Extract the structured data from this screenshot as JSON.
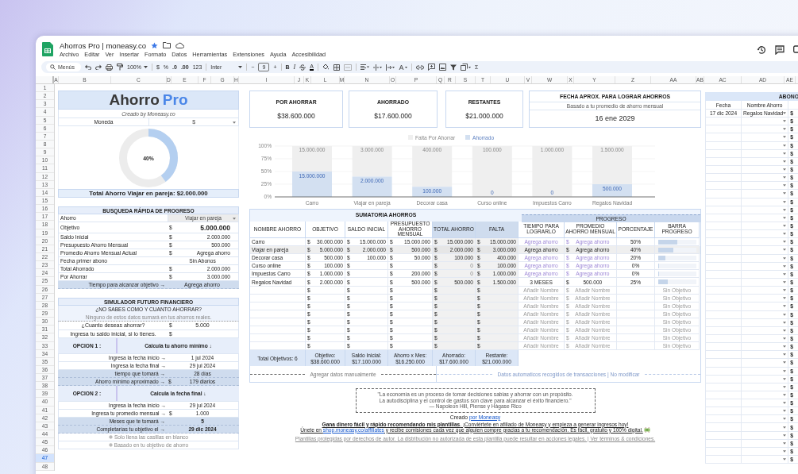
{
  "window": {
    "title": "Ahorros Pro | moneasy.co",
    "menu": [
      "Archivo",
      "Editar",
      "Ver",
      "Insertar",
      "Formato",
      "Datos",
      "Herramientas",
      "Extensiones",
      "Ayuda",
      "Accesibilidad"
    ]
  },
  "toolbar": {
    "search": "Menús",
    "zoom": "100%",
    "currency": "$",
    "percent": "%",
    "dec_less": ".0",
    "dec_more": ".00",
    "format": "123",
    "font": "Inter",
    "minus": "−",
    "font_size": "9",
    "plus": "+",
    "bold": "B",
    "italic": "I",
    "text_color": "A",
    "sum": "Σ"
  },
  "columns": [
    "A",
    "B",
    "C",
    "D",
    "E",
    "F",
    "G",
    "H",
    "I",
    "J",
    "K",
    "L",
    "M",
    "N",
    "O",
    "P",
    "Q",
    "R",
    "S",
    "T",
    "U",
    "V",
    "W",
    "X",
    "Y",
    "Z",
    "AA",
    "AB",
    "AC",
    "AD",
    "AE"
  ],
  "rows": [
    {
      "label": "1",
      "selected": false
    },
    {
      "label": "2",
      "selected": false
    },
    {
      "label": "3",
      "selected": false
    },
    {
      "label": "4",
      "selected": false
    },
    {
      "label": "5",
      "selected": false
    },
    {
      "label": "6",
      "selected": false
    },
    {
      "label": "7",
      "selected": false
    },
    {
      "label": "8",
      "selected": false
    },
    {
      "label": "9",
      "selected": false
    },
    {
      "label": "10",
      "selected": false
    },
    {
      "label": "11",
      "selected": false
    },
    {
      "label": "12",
      "selected": false
    },
    {
      "label": "13",
      "selected": false
    },
    {
      "label": "14",
      "selected": false
    },
    {
      "label": "15",
      "selected": false
    },
    {
      "label": "16",
      "selected": false
    },
    {
      "label": "17",
      "selected": false
    },
    {
      "label": "18",
      "selected": false
    },
    {
      "label": "19",
      "selected": false
    },
    {
      "label": "20",
      "selected": false
    },
    {
      "label": "21",
      "selected": false
    },
    {
      "label": "22",
      "selected": false
    },
    {
      "label": "23",
      "selected": false
    },
    {
      "label": "24",
      "selected": false
    },
    {
      "label": "25",
      "selected": false
    },
    {
      "label": "26",
      "selected": false
    },
    {
      "label": "27",
      "selected": false
    },
    {
      "label": "28",
      "selected": false
    },
    {
      "label": "29",
      "selected": false
    },
    {
      "label": "30",
      "selected": false
    },
    {
      "label": "31",
      "selected": false
    },
    {
      "label": "32",
      "selected": false
    },
    {
      "label": "33",
      "selected": false
    },
    {
      "label": "34",
      "selected": false
    },
    {
      "label": "35",
      "selected": false
    },
    {
      "label": "36",
      "selected": false
    },
    {
      "label": "37",
      "selected": false
    },
    {
      "label": "38",
      "selected": false
    },
    {
      "label": "39",
      "selected": false
    },
    {
      "label": "40",
      "selected": false
    },
    {
      "label": "41",
      "selected": false
    },
    {
      "label": "42",
      "selected": false
    },
    {
      "label": "43",
      "selected": false
    },
    {
      "label": "44",
      "selected": false
    },
    {
      "label": "45",
      "selected": false
    },
    {
      "label": "46",
      "selected": false
    },
    {
      "label": "47",
      "selected": true
    },
    {
      "label": "48",
      "selected": false
    }
  ],
  "left": {
    "title": {
      "main": "Ahorro",
      "accent": "Pro"
    },
    "subtitle": "Creado by Moneasy.co",
    "currency": {
      "label": "Moneda",
      "value": "$"
    },
    "progress": {
      "level": 0.4,
      "reading": "40%"
    },
    "total": "Total Ahorro Viajar en pareja: $2.000.000",
    "search": {
      "title": "BUSQUEDA RÁPIDA DE PROGRESO",
      "select": {
        "label": "Ahorro",
        "value": "Viajar en pareja"
      },
      "rows": [
        {
          "label": "Objetivo",
          "sym": "$",
          "value": "5.000.000",
          "kind": "big"
        },
        {
          "label": "Saldo Inicial",
          "sym": "$",
          "value": "2.000.000",
          "kind": "plain"
        },
        {
          "label": "Presupuesto Ahorro Mensual",
          "sym": "$",
          "value": "500.000",
          "kind": "plain"
        },
        {
          "label": "Promedio Ahorro Mensual Actual",
          "sym": "$",
          "value": "Agrega ahorro",
          "kind": "plain"
        },
        {
          "label": "Fecha primer abono",
          "value": "Sin Abonos",
          "kind": "plain"
        },
        {
          "label": "Total Ahorrado",
          "sym": "$",
          "value": "2.000.000",
          "kind": "plain"
        },
        {
          "label": "Por Ahorrar",
          "sym": "$",
          "value": "3.000.000",
          "kind": "plain"
        }
      ],
      "result": {
        "label": "Tiempo para alcanzar objetivo →",
        "value": "Agrega ahorro"
      }
    },
    "simulator": {
      "title": "SIMULADOR FUTURO FINANCIERO",
      "question": "¿NO SABES COMO Y CUANTO AHORRAR?",
      "note": "Ninguno de estos datos sumará en tus ahorros reales.",
      "inputs": [
        {
          "label": "¿Cuanto deseas ahorrar?",
          "sym": "$",
          "value": "5.000"
        },
        {
          "label": "Ingresa tu saldo inicial, si lo tienes.",
          "sym": "$"
        }
      ],
      "options": [
        {
          "label": "OPCION 1 :",
          "heading": "Calcula tu ahorro mínimo ↓",
          "rows": [
            {
              "label": "Ingresa la fecha inicio →",
              "value": "1 jul 2024",
              "kind": "input"
            },
            {
              "label": "Ingresa la fecha final →",
              "value": "29 jul 2024",
              "kind": "input"
            },
            {
              "label": "tiempo que tomará →",
              "value": "28 días",
              "kind": "result"
            },
            {
              "label": "Ahorro mínimo aproximado →",
              "sym": "$",
              "value": "179 diarios",
              "kind": "result"
            }
          ]
        },
        {
          "label": "OPCION 2 :",
          "heading": "Calcula la fecha final ↓",
          "rows": [
            {
              "label": "Ingresa la fecha inicio →",
              "value": "29 jul 2024",
              "kind": "input"
            },
            {
              "label": "Ingresa tu promedio mensual →",
              "sym": "$",
              "value": "1.000",
              "kind": "input"
            },
            {
              "label": "Meses que te tomará →",
              "value": "5",
              "kind": "strong"
            },
            {
              "label": "Completarías tu objetivo el →",
              "value": "29 dic 2024",
              "kind": "strong"
            }
          ]
        }
      ],
      "hints": [
        "Solo llena las casillas en blanco",
        "Basado en tu objetivo de ahorro"
      ]
    }
  },
  "cards": [
    {
      "label": "POR AHORRAR",
      "value": "$38.600.000"
    },
    {
      "label": "AHORRADO",
      "value": "$17.600.000"
    },
    {
      "label": "RESTANTES",
      "value": "$21.000.000"
    }
  ],
  "date_card": {
    "title": "FECHA APROX. PARA LOGRAR AHORROS",
    "note": "Basado a tu promedio de ahorro mensual",
    "value": "16 ene 2029"
  },
  "chart_data": {
    "type": "bar",
    "stacked": true,
    "ylim": [
      0,
      1
    ],
    "categories": [
      "Carro",
      "Viajar en pareja",
      "Decorar casa",
      "Curso online",
      "Impuestos Carro",
      "Regalos Navidad"
    ],
    "series": [
      {
        "name": "Falta Por Ahorrar",
        "color": "#efefef",
        "values": [
          0.5,
          0.6,
          0.8,
          1,
          1,
          0.75
        ]
      },
      {
        "name": "Ahorrado",
        "color": "#d3e0f1",
        "values": [
          0.5,
          0.4,
          0.2,
          0,
          0,
          0.25
        ]
      }
    ],
    "value_labels": [
      [
        "15.000.000",
        "3.000.000",
        "400.000",
        "100.000",
        "1.000.000",
        "1.500.000"
      ],
      [
        "15.000.000",
        "2.000.000",
        "100.000",
        "0",
        "0",
        "500.000"
      ]
    ],
    "yticks": [
      {
        "value": 0,
        "label": "0%"
      },
      {
        "value": 0.25,
        "label": "25%"
      },
      {
        "value": 0.5,
        "label": "50%"
      },
      {
        "value": 0.75,
        "label": "75%"
      },
      {
        "value": 1,
        "label": "100%"
      }
    ],
    "grid": true,
    "legend": "top"
  },
  "table": {
    "title": "SUMATORIA AHORROS",
    "group": "PROGRESO",
    "columns": [
      "NOMBRE AHORRO",
      "OBJETIVO",
      "SALDO INICIAL",
      "PRESUPUESTO AHORRO MENSUAL",
      "TOTAL AHORRO",
      "FALTA",
      "TIEMPO PARA LOGRARLO",
      "PROMEDIO AHORRO MENSUAL",
      "PORCENTAJE",
      "BARRA PROGRESO"
    ],
    "rows": [
      {
        "kind": "goal",
        "name": "Carro",
        "sym": [
          "$",
          "$",
          "$",
          "$",
          "$",
          "$"
        ],
        "objetivo": "30.000.000",
        "saldo": "15.000.000",
        "presupuesto": "15.000.000",
        "total": "15.000.000",
        "falta": "15.000.000",
        "tiempo": "Agrega ahorro",
        "promedio": "Agrega ahorro",
        "porcentaje": "50%",
        "level": 0.5,
        "dimmed": true,
        "highlighted": false,
        "total_dimmed": false
      },
      {
        "kind": "goal",
        "name": "Viajar en pareja",
        "sym": [
          "$",
          "$",
          "$",
          "$",
          "$",
          "$"
        ],
        "objetivo": "5.000.000",
        "saldo": "2.000.000",
        "presupuesto": "500.000",
        "total": "2.000.000",
        "falta": "3.000.000",
        "tiempo": "Agrega ahorro",
        "promedio": "Agrega ahorro",
        "porcentaje": "40%",
        "level": 0.4,
        "dimmed": false,
        "highlighted": true,
        "total_dimmed": false
      },
      {
        "kind": "goal",
        "name": "Decorar casa",
        "sym": [
          "$",
          "$",
          "$",
          "$",
          "$",
          "$"
        ],
        "objetivo": "500.000",
        "saldo": "100.000",
        "presupuesto": "50.000",
        "total": "100.000",
        "falta": "400.000",
        "tiempo": "Agrega ahorro",
        "promedio": "Agrega ahorro",
        "porcentaje": "20%",
        "level": 0.2,
        "dimmed": true,
        "highlighted": false,
        "total_dimmed": false
      },
      {
        "kind": "goal",
        "name": "Curso online",
        "sym": [
          "$",
          "$",
          "$",
          "$",
          "$",
          "$"
        ],
        "objetivo": "100.000",
        "total": "0",
        "falta": "100.000",
        "tiempo": "Agrega ahorro",
        "promedio": "Agrega ahorro",
        "porcentaje": "0%",
        "level": 0,
        "dimmed": true,
        "highlighted": false,
        "total_dimmed": true
      },
      {
        "kind": "goal",
        "name": "Impuestos Carro",
        "sym": [
          "$",
          "$",
          "$",
          "$",
          "$",
          "$"
        ],
        "objetivo": "1.000.000",
        "presupuesto": "200.000",
        "total": "0",
        "falta": "1.000.000",
        "tiempo": "Agrega ahorro",
        "promedio": "Agrega ahorro",
        "porcentaje": "0%",
        "level": 0,
        "dimmed": true,
        "highlighted": false,
        "total_dimmed": true
      },
      {
        "kind": "goal",
        "name": "Regalos Navidad",
        "sym": [
          "$",
          "$",
          "$",
          "$",
          "$",
          "$"
        ],
        "objetivo": "2.000.000",
        "presupuesto": "500.000",
        "total": "500.000",
        "falta": "1.500.000",
        "tiempo": "3 MESES",
        "promedio": "500.000",
        "porcentaje": "25%",
        "level": 0.25,
        "dimmed": false,
        "highlighted": false,
        "total_dimmed": false
      },
      {
        "kind": "empty",
        "sym": [
          "$",
          "$",
          "$",
          "$",
          "$",
          "$"
        ],
        "tiempo": "Añadir Nombre",
        "promedio": "Añadir Nombre",
        "barra": "Sin Objetivo"
      },
      {
        "kind": "empty",
        "sym": [
          "$",
          "$",
          "$",
          "$",
          "$",
          "$"
        ],
        "tiempo": "Añadir Nombre",
        "promedio": "Añadir Nombre",
        "barra": "Sin Objetivo"
      },
      {
        "kind": "empty",
        "sym": [
          "$",
          "$",
          "$",
          "$",
          "$",
          "$"
        ],
        "tiempo": "Añadir Nombre",
        "promedio": "Añadir Nombre",
        "barra": "Sin Objetivo"
      },
      {
        "kind": "empty",
        "sym": [
          "$",
          "$",
          "$",
          "$",
          "$",
          "$"
        ],
        "tiempo": "Añadir Nombre",
        "promedio": "Añadir Nombre",
        "barra": "Sin Objetivo"
      },
      {
        "kind": "empty",
        "sym": [
          "$",
          "$",
          "$",
          "$",
          "$",
          "$"
        ],
        "tiempo": "Añadir Nombre",
        "promedio": "Añadir Nombre",
        "barra": "Sin Objetivo"
      },
      {
        "kind": "empty",
        "sym": [
          "$",
          "$",
          "$",
          "$",
          "$",
          "$"
        ],
        "tiempo": "Añadir Nombre",
        "promedio": "Añadir Nombre",
        "barra": "Sin Objetivo"
      },
      {
        "kind": "empty",
        "sym": [
          "$",
          "$",
          "$",
          "$",
          "$",
          "$"
        ],
        "tiempo": "Añadir Nombre",
        "promedio": "Añadir Nombre",
        "barra": "Sin Objetivo"
      },
      {
        "kind": "empty",
        "sym": [
          "$",
          "$",
          "$",
          "$",
          "$",
          "$"
        ],
        "tiempo": "Añadir Nombre",
        "promedio": "Añadir Nombre",
        "barra": "Sin Objetivo"
      }
    ],
    "totals_label": "Total Objetivos: 6",
    "totals": [
      {
        "label": "Objetivo:",
        "value": "$38.600.000"
      },
      {
        "label": "Saldo Inicial:",
        "value": "$17.100.000"
      },
      {
        "label": "Ahorro x Mes:",
        "value": "$16.250.000"
      },
      {
        "label": "Ahorrado:",
        "value": "$17.600.000"
      },
      {
        "label": "Restante:",
        "value": "$21.000.000"
      }
    ],
    "manual": "Agregar datos manualmente",
    "auto": "Datos automaticos recogidos de transacciones | No modificar"
  },
  "quote": [
    "\"La economía es un proceso de tomar decisiones sabias y ahorrar con un propósito.",
    "La autodisciplina y el control de gastos son clave para alcanzar el éxito financiero.\"",
    "— Napoleon Hill, Piense y Hágase Rico"
  ],
  "credit": {
    "text": "Creado",
    "link": "por Moneasy"
  },
  "promo": "**Gana dinero fácil y rápido recomendando mis plantillas**. ¡Conviértete en afiliado de Moneasy y empieza a generar ingresos hoy!",
  "affiliate": {
    "before": "Únete en",
    "link": "shop.moneasy.co/affiliates",
    "after": "y recibe comisiones cada vez que alguien compre gracias a tu recomendación. Es fácil, gratuito y 100% digital."
  },
  "legal": "Plantillas protegidas por derechos de autor. La distribución no autorizada de esta plantilla puede resultar en acciones legales. | Ver términos & condiciones.",
  "abonos": {
    "title": "ABONO",
    "columns": [
      "Fecha",
      "Nombre Ahorro"
    ],
    "rows": [
      {
        "fecha": "17 dic 2024",
        "nombre": "Regalos Navidad",
        "sym": "$"
      },
      {
        "sym": "$"
      },
      {
        "sym": "$"
      },
      {
        "sym": "$"
      },
      {
        "sym": "$"
      },
      {
        "sym": "$"
      },
      {
        "sym": "$"
      },
      {
        "sym": "$"
      },
      {
        "sym": "$"
      },
      {
        "sym": "$"
      },
      {
        "sym": "$"
      },
      {
        "sym": "$"
      },
      {
        "sym": "$"
      },
      {
        "sym": "$"
      },
      {
        "sym": "$"
      },
      {
        "sym": "$"
      },
      {
        "sym": "$"
      },
      {
        "sym": "$"
      },
      {
        "sym": "$"
      },
      {
        "sym": "$"
      },
      {
        "sym": "$"
      },
      {
        "sym": "$"
      },
      {
        "sym": "$"
      },
      {
        "sym": "$"
      },
      {
        "sym": "$"
      },
      {
        "sym": "$"
      },
      {
        "sym": "$"
      },
      {
        "sym": "$"
      },
      {
        "sym": "$"
      },
      {
        "sym": "$"
      },
      {
        "sym": "$"
      },
      {
        "sym": "$"
      },
      {
        "sym": "$"
      },
      {
        "sym": "$"
      },
      {
        "sym": "$"
      },
      {
        "sym": "$"
      },
      {
        "sym": "$"
      },
      {
        "sym": "$"
      },
      {
        "sym": "$"
      },
      {
        "sym": "$"
      },
      {
        "sym": "$"
      },
      {
        "sym": "$"
      },
      {
        "sym": "$"
      },
      {
        "sym": "$"
      }
    ]
  }
}
